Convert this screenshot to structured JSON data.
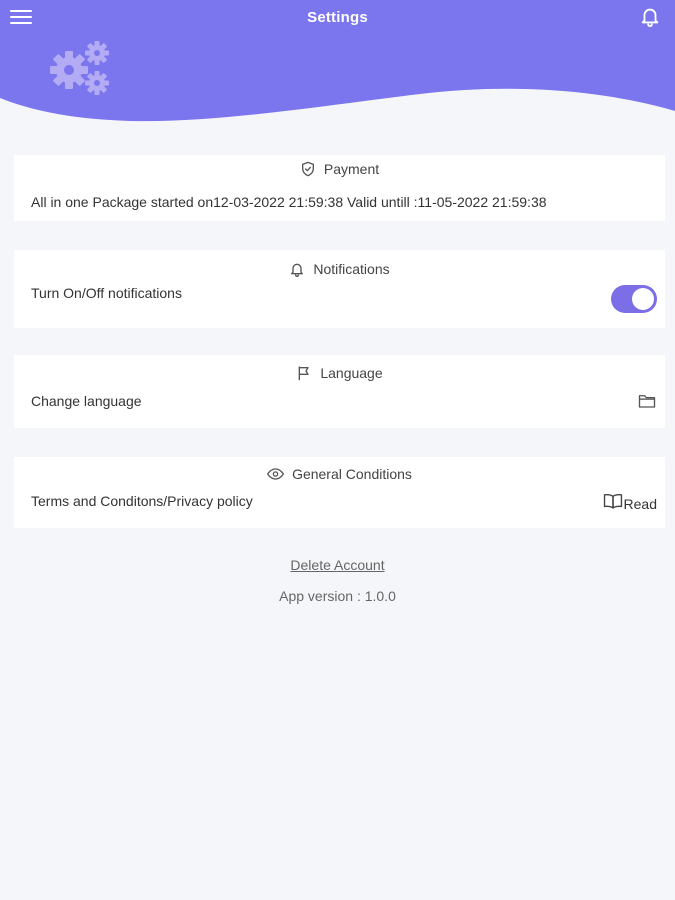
{
  "header": {
    "title": "Settings",
    "accent_color": "#7b75ee",
    "menu_icon": "hamburger-menu-icon",
    "bell_icon": "bell-icon",
    "banner_icon": "gears-icon"
  },
  "payment": {
    "title": "Payment",
    "icon": "shield-check-icon",
    "info": "All in one Package started on12-03-2022 21:59:38 Valid untill :11-05-2022 21:59:38"
  },
  "notifications": {
    "title": "Notifications",
    "icon": "bell-icon",
    "label": "Turn On/Off notifications",
    "enabled": true
  },
  "language": {
    "title": "Language",
    "icon": "flag-icon",
    "label": "Change language",
    "action_icon": "folder-icon"
  },
  "conditions": {
    "title": "General Conditions",
    "icon": "eye-icon",
    "label": "Terms and Conditons/Privacy policy",
    "action_icon": "book-icon",
    "action_label": "Read"
  },
  "footer": {
    "delete_account": "Delete Account",
    "app_version": "App version : 1.0.0"
  }
}
